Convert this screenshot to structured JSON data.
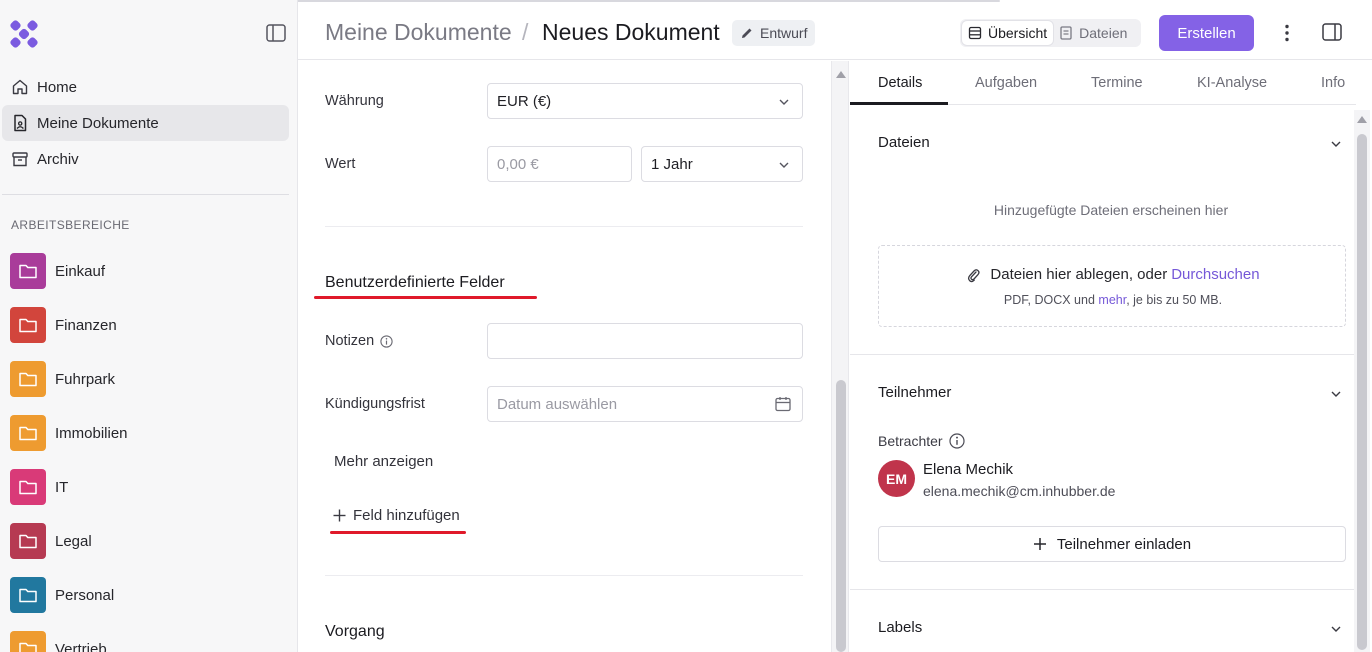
{
  "sidebar": {
    "nav": [
      {
        "label": "Home",
        "icon": "home-icon"
      },
      {
        "label": "Meine Dokumente",
        "icon": "document-icon",
        "active": true
      },
      {
        "label": "Archiv",
        "icon": "archive-icon"
      }
    ],
    "section_label": "ARBEITSBEREICHE",
    "workspaces": [
      {
        "label": "Einkauf",
        "color": "#a93c9a"
      },
      {
        "label": "Finanzen",
        "color": "#d2453c"
      },
      {
        "label": "Fuhrpark",
        "color": "#ee9b30"
      },
      {
        "label": "Immobilien",
        "color": "#ee9b30"
      },
      {
        "label": "IT",
        "color": "#d93a78"
      },
      {
        "label": "Legal",
        "color": "#b63a52"
      },
      {
        "label": "Personal",
        "color": "#21789f"
      },
      {
        "label": "Vertrieb",
        "color": "#ee9b30"
      }
    ]
  },
  "header": {
    "breadcrumb_parent": "Meine Dokumente",
    "breadcrumb_sep": "/",
    "title": "Neues Dokument",
    "status_badge": "Entwurf",
    "view_toggle": [
      "Übersicht",
      "Dateien"
    ],
    "create_label": "Erstellen"
  },
  "form": {
    "currency_label": "Währung",
    "currency_value": "EUR (€)",
    "value_label": "Wert",
    "value_placeholder": "0,00 €",
    "period_value": "1 Jahr",
    "custom_fields_title": "Benutzerdefinierte Felder",
    "notes_label": "Notizen",
    "notice_label": "Kündigungsfrist",
    "date_placeholder": "Datum auswählen",
    "show_more": "Mehr anzeigen",
    "add_field": "Feld hinzufügen",
    "process_title": "Vorgang"
  },
  "right_panel": {
    "tabs": [
      "Details",
      "Aufgaben",
      "Termine",
      "KI-Analyse",
      "Info"
    ],
    "files": {
      "title": "Dateien",
      "empty_text": "Hinzugefügte Dateien erscheinen hier",
      "drop_text": "Dateien hier ablegen, oder",
      "browse_link": "Durchsuchen",
      "hint_prefix": "PDF, DOCX und",
      "hint_link": "mehr",
      "hint_suffix": ", je bis zu 50 MB."
    },
    "participants": {
      "title": "Teilnehmer",
      "watchers_label": "Betrachter",
      "person_initials": "EM",
      "person_name": "Elena Mechik",
      "person_email": "elena.mechik@cm.inhubber.de",
      "invite_label": "Teilnehmer einladen"
    },
    "labels": {
      "title": "Labels"
    }
  },
  "colors": {
    "accent": "#8462e6",
    "annotation_red": "#e0192a"
  }
}
